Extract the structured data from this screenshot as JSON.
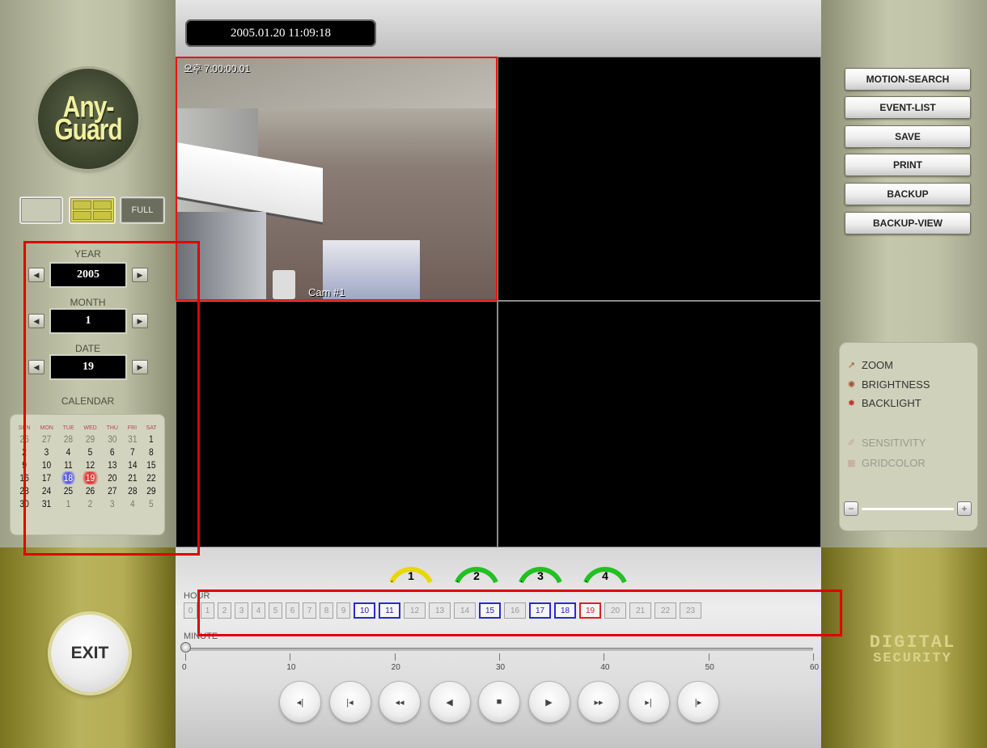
{
  "app": {
    "datetime": "2005.01.20   11:09:18"
  },
  "logo": {
    "line1": "Any-",
    "line2": "Guard"
  },
  "view_modes": {
    "full_label": "FULL"
  },
  "date_select": {
    "year_label": "YEAR",
    "year_value": "2005",
    "month_label": "MONTH",
    "month_value": "1",
    "date_label": "DATE",
    "date_value": "19"
  },
  "calendar": {
    "title": "CALENDAR",
    "weekdays": [
      "SUN",
      "MON",
      "TUE",
      "WED",
      "THU",
      "FRI",
      "SAT"
    ],
    "weeks": [
      [
        "26",
        "27",
        "28",
        "29",
        "30",
        "31",
        "1"
      ],
      [
        "2",
        "3",
        "4",
        "5",
        "6",
        "7",
        "8"
      ],
      [
        "9",
        "10",
        "11",
        "12",
        "13",
        "14",
        "15"
      ],
      [
        "16",
        "17",
        "18",
        "19",
        "20",
        "21",
        "22"
      ],
      [
        "23",
        "24",
        "25",
        "26",
        "27",
        "28",
        "29"
      ],
      [
        "30",
        "31",
        "1",
        "2",
        "3",
        "4",
        "5"
      ]
    ],
    "highlight_blue": "18",
    "highlight_red": "19"
  },
  "exit_label": "EXIT",
  "video": {
    "cam1_time": "오후 7:00:00.01",
    "cam1_label": "Cam #1"
  },
  "cameras": [
    {
      "num": "1",
      "color": "#e8d800"
    },
    {
      "num": "2",
      "color": "#22c022"
    },
    {
      "num": "3",
      "color": "#22c022"
    },
    {
      "num": "4",
      "color": "#22c022"
    }
  ],
  "timeline": {
    "hour_label": "HOUR",
    "hours": [
      "0",
      "1",
      "2",
      "3",
      "4",
      "5",
      "6",
      "7",
      "8",
      "9",
      "10",
      "11",
      "12",
      "13",
      "14",
      "15",
      "16",
      "17",
      "18",
      "19",
      "20",
      "21",
      "22",
      "23"
    ],
    "active_hours": [
      "10",
      "11",
      "15",
      "17",
      "18"
    ],
    "current_hour": "19",
    "minute_label": "MINUTE",
    "minute_ticks": [
      "0",
      "10",
      "20",
      "30",
      "40",
      "50",
      "60"
    ],
    "minute_value": 0
  },
  "playback": {
    "buttons": [
      {
        "name": "step-back-button",
        "glyph": "◂|"
      },
      {
        "name": "go-start-button",
        "glyph": "|◂"
      },
      {
        "name": "fast-rewind-button",
        "glyph": "◂◂"
      },
      {
        "name": "reverse-play-button",
        "glyph": "◀"
      },
      {
        "name": "stop-button",
        "glyph": "■"
      },
      {
        "name": "play-button",
        "glyph": "▶"
      },
      {
        "name": "fast-forward-button",
        "glyph": "▸▸"
      },
      {
        "name": "go-end-button",
        "glyph": "▸|"
      },
      {
        "name": "step-forward-button",
        "glyph": "|▸"
      }
    ]
  },
  "actions": {
    "motion_search": "MOTION-SEARCH",
    "event_list": "EVENT-LIST",
    "save": "SAVE",
    "print": "PRINT",
    "backup": "BACKUP",
    "backup_view": "BACKUP-VIEW"
  },
  "options": {
    "zoom": "ZOOM",
    "brightness": "BRIGHTNESS",
    "backlight": "BACKLIGHT",
    "sensitivity": "SENSITIVITY",
    "gridcolor": "GRIDCOLOR",
    "minus": "−",
    "plus": "+"
  },
  "brand": {
    "line1": "DIGITAL",
    "line2": "SECURITY"
  },
  "colors": {
    "accent_red": "#e00000",
    "active_blue": "#2a2ad0",
    "olive": "#b9b35d"
  }
}
